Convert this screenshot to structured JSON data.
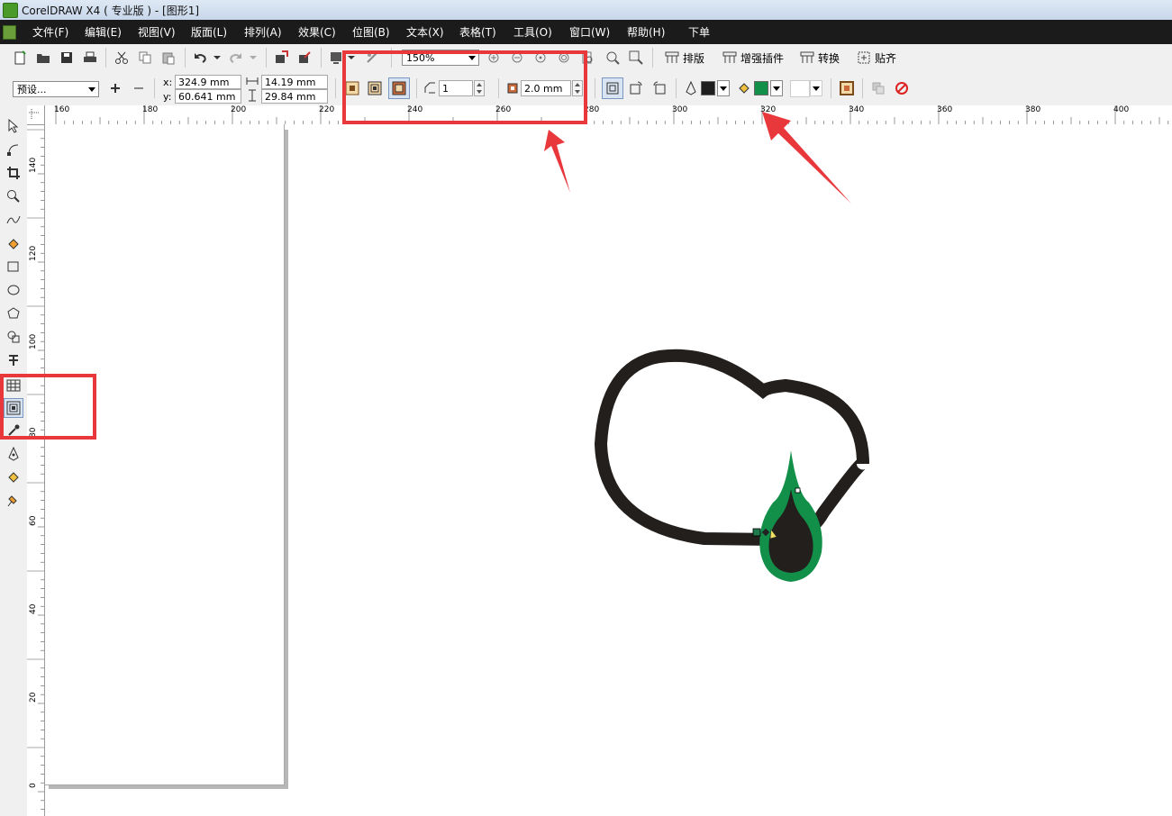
{
  "window": {
    "title": "CorelDRAW X4 ( 专业版 ) - [图形1]"
  },
  "menu": {
    "items": [
      "文件(F)",
      "编辑(E)",
      "视图(V)",
      "版面(L)",
      "排列(A)",
      "效果(C)",
      "位图(B)",
      "文本(X)",
      "表格(T)",
      "工具(O)",
      "窗口(W)",
      "帮助(H)",
      "下单"
    ]
  },
  "toolbar": {
    "zoom_value": "150%",
    "layout_label": "排版",
    "plugin_label": "增强插件",
    "convert_label": "转换",
    "snap_label": "贴齐"
  },
  "property_bar": {
    "preset_value": "预设...",
    "x_label": "x:",
    "x_value": "324.9 mm",
    "y_label": "y:",
    "y_value": "60.641 mm",
    "width_value": "14.19 mm",
    "height_value": "29.84 mm",
    "steps_value": "1",
    "offset_value": "2.0 mm",
    "outline_color": "#1e1e1e",
    "fill_color": "#12904a"
  },
  "rulers": {
    "horizontal": [
      "160",
      "180",
      "200",
      "220",
      "240",
      "260",
      "280",
      "300",
      "320",
      "340",
      "360",
      "380",
      "400"
    ],
    "vertical": [
      "140",
      "120",
      "100",
      "80",
      "60",
      "40",
      "20",
      "0"
    ]
  },
  "colors": {
    "highlight": "#e8383c",
    "drawing_stroke": "#231f1c",
    "drawing_contour": "#12904a"
  },
  "icons": {
    "toolbox": [
      "pick-icon",
      "shape-icon",
      "crop-icon",
      "zoom-icon",
      "freehand-icon",
      "smart-fill-icon",
      "rectangle-icon",
      "ellipse-icon",
      "polygon-icon",
      "basic-shapes-icon",
      "text-icon",
      "table-icon",
      "contour-icon",
      "eyedropper-icon",
      "outline-pen-icon",
      "fill-icon",
      "interactive-fill-icon"
    ]
  }
}
